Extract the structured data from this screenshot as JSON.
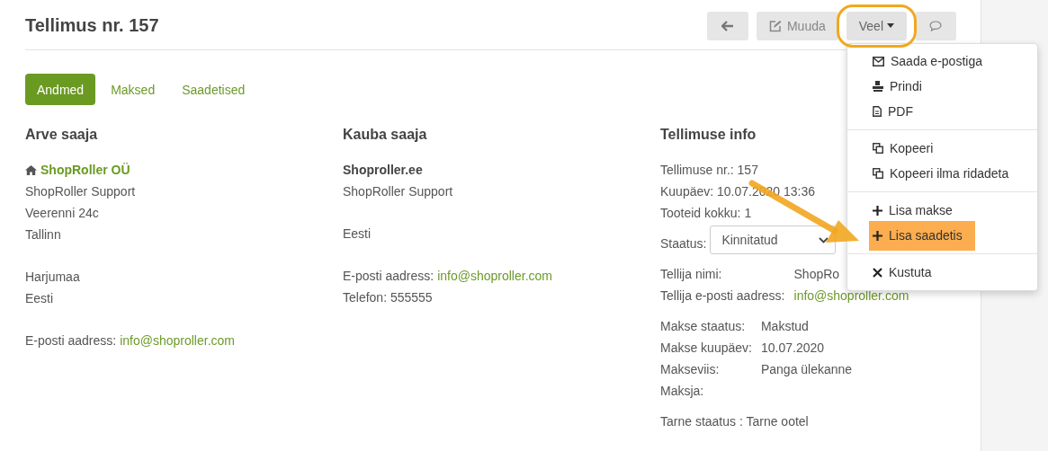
{
  "header": {
    "title": "Tellimus nr. 157",
    "buttons": [
      {
        "kind": "back",
        "highlighted": false
      },
      {
        "kind": "edit",
        "label": "Muuda",
        "highlighted": false
      },
      {
        "kind": "more",
        "label": "Veel",
        "highlighted": true
      },
      {
        "kind": "comment",
        "highlighted": false
      }
    ]
  },
  "tabs": [
    {
      "label": "Andmed",
      "selected": true
    },
    {
      "label": "Maksed",
      "selected": false
    },
    {
      "label": "Saadetised",
      "selected": false
    }
  ],
  "columns": [
    {
      "heading": "Arve saaja",
      "blocks": [
        [
          {
            "kind": "company",
            "text": "ShopRoller OÜ"
          },
          {
            "kind": "plain",
            "text": "ShopRoller Support"
          },
          {
            "kind": "plain",
            "text": "Veerenni 24c"
          },
          {
            "kind": "plain",
            "text": "Tallinn"
          }
        ],
        [
          {
            "kind": "plain",
            "text": "Harjumaa"
          },
          {
            "kind": "plain",
            "text": "Eesti"
          }
        ],
        [
          {
            "kind": "email",
            "label": "E-posti aadress:",
            "text": "info@shoproller.com"
          }
        ]
      ]
    },
    {
      "heading": "Kauba saaja",
      "blocks": [
        [
          {
            "kind": "bold",
            "text": "Shoproller.ee"
          },
          {
            "kind": "plain",
            "text": "ShopRoller Support"
          }
        ],
        [
          {
            "kind": "plain",
            "text": "Eesti"
          }
        ],
        [
          {
            "kind": "email",
            "label": "E-posti aadress:",
            "text": "info@shoproller.com"
          },
          {
            "kind": "plain",
            "text": "Telefon: 555555"
          }
        ]
      ]
    }
  ],
  "info": {
    "heading": "Tellimuse info",
    "lines": [
      "Tellimuse nr.: 157",
      "Kuupäev: 10.07.2020 13:36",
      "Tooteid kokku: 1"
    ],
    "status": {
      "label": "Staatus:",
      "value": "Kinnitatud"
    },
    "tables": [
      [
        {
          "label": "Tellija nimi:",
          "value": "ShopRo",
          "kind": "plain"
        },
        {
          "label": "Tellija e-posti aadress:",
          "value": "info@shoproller.com",
          "kind": "link"
        }
      ],
      [
        {
          "label": "Makse staatus:",
          "value": "Makstud",
          "kind": "plain"
        },
        {
          "label": "Makse kuupäev:",
          "value": "10.07.2020",
          "kind": "plain"
        },
        {
          "label": "Makseviis:",
          "value": "Panga ülekanne",
          "kind": "plain"
        },
        {
          "label": "Maksja:",
          "kind": "plain"
        }
      ]
    ],
    "delivery": "Tarne staatus : Tarne ootel"
  },
  "menu": [
    [
      {
        "kind": "mail",
        "label": "Saada e-postiga",
        "highlighted": false
      },
      {
        "kind": "print",
        "label": "Prindi",
        "highlighted": false
      },
      {
        "kind": "file",
        "label": "PDF",
        "highlighted": false
      }
    ],
    [
      {
        "kind": "copy",
        "label": "Kopeeri",
        "highlighted": false
      },
      {
        "kind": "copy",
        "label": "Kopeeri ilma ridadeta",
        "highlighted": false
      }
    ],
    [
      {
        "kind": "add",
        "label": "Lisa makse",
        "highlighted": false
      },
      {
        "kind": "add",
        "label": "Lisa saadetis",
        "highlighted": true
      }
    ],
    [
      {
        "kind": "delete",
        "label": "Kustuta",
        "highlighted": false
      }
    ]
  ]
}
